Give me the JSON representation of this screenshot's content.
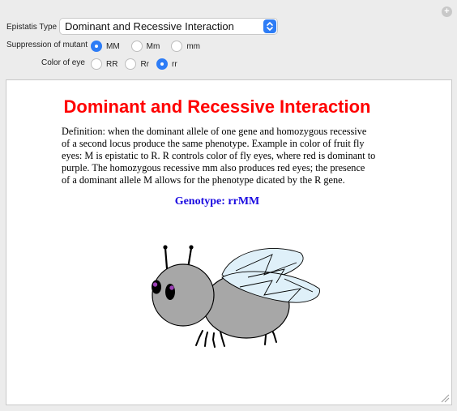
{
  "controls": {
    "epistasis_label": "Epistatis Type",
    "epistasis_value": "Dominant and Recessive Interaction",
    "suppression_label": "Suppression of mutant",
    "suppression_options": [
      "MM",
      "Mm",
      "mm"
    ],
    "suppression_selected": "MM",
    "eye_label": "Color of eye",
    "eye_options": [
      "RR",
      "Rr",
      "rr"
    ],
    "eye_selected": "rr"
  },
  "content": {
    "title": "Dominant and Recessive Interaction",
    "definition_lines": [
      "Definition: when the dominant allele of one gene and homozygous recessive",
      "of a second locus produce the same phenotype. Example in color of fruit fly",
      "eyes: M is epistatic to R. R controls color of fly eyes, where red is dominant to",
      "purple. The homozygous recessive mm also produces red eyes; the presence",
      "of a dominant allele M allows for the phenotype dicated by the R gene."
    ],
    "genotype": "Genotype: rrMM"
  },
  "icons": {
    "reset": "plus-icon",
    "stepper": "up-down-chevron-icon",
    "resize": "resize-grip-icon"
  },
  "colors": {
    "accent": "#2d7cf6",
    "title": "#ff0000",
    "genotype": "#1a0ae0",
    "eye_pupil": "#9b3fb5"
  }
}
